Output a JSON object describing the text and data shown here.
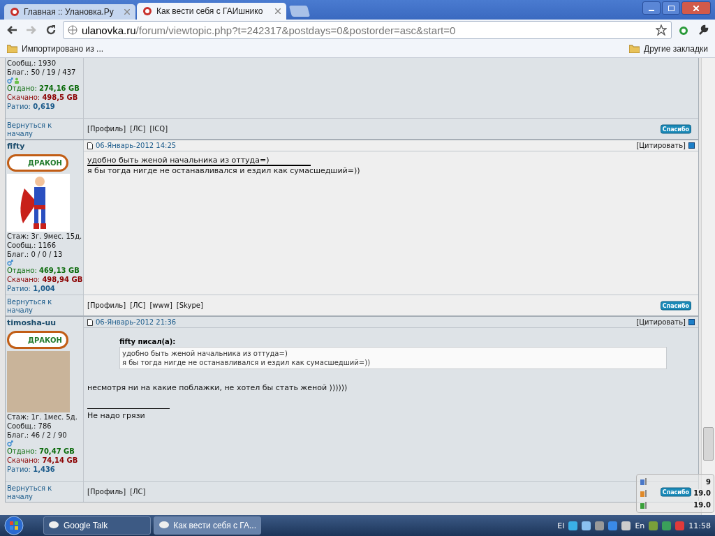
{
  "browser": {
    "tabs": [
      {
        "label": "Главная :: Улановка.Ру",
        "selected": false
      },
      {
        "label": "Как вести себя с ГАИшнико",
        "selected": true
      }
    ],
    "address": {
      "host": "ulanovka.ru",
      "path": "/forum/viewtopic.php?t=242317&postdays=0&postorder=asc&start=0"
    },
    "bookmarks": [
      {
        "label": "Импортировано из ..."
      },
      {
        "label": "Другие закладки"
      }
    ]
  },
  "posts": [
    {
      "stats": [
        {
          "kind": "plain",
          "label": "Сообщ.:",
          "value": "1930"
        },
        {
          "kind": "plain",
          "label": "Благ.:",
          "value": "50 / 19 / 437"
        },
        {
          "kind": "badges",
          "extra": true
        },
        {
          "kind": "up",
          "label": "Отдано:",
          "value": "274,16 GB"
        },
        {
          "kind": "down",
          "label": "Скачано:",
          "value": "498,5 GB"
        },
        {
          "kind": "ratio",
          "label": "Ратио:",
          "value": "0,619"
        }
      ],
      "back": "Вернуться к началу",
      "links": [
        "[Профиль]",
        "[ЛС]",
        "[ICQ]"
      ],
      "thanks": "Спасибо"
    },
    {
      "author": "fifty",
      "rank": "ДРАКОН",
      "date": "06-Январь-2012 14:25",
      "quote_action": "[Цитировать]",
      "avatar": {
        "kind": "figure"
      },
      "stats": [
        {
          "kind": "plain",
          "label": "Стаж:",
          "value": "3г. 9мес. 15д."
        },
        {
          "kind": "plain",
          "label": "Сообщ.:",
          "value": "1166"
        },
        {
          "kind": "plain",
          "label": "Благ.:",
          "value": "0 / 0 / 13"
        },
        {
          "kind": "badges",
          "extra": false
        },
        {
          "kind": "up",
          "label": "Отдано:",
          "value": "469,13 GB"
        },
        {
          "kind": "down",
          "label": "Скачано:",
          "value": "498,94 GB"
        },
        {
          "kind": "ratio",
          "label": "Ратио:",
          "value": "1,004"
        }
      ],
      "body": [
        {
          "text": "удобно быть женой начальника из оттуда=)",
          "underlined": true
        },
        {
          "text": "я бы тогда нигде не останавливался и ездил как сумасшедший=))",
          "underlined": false
        }
      ],
      "back": "Вернуться к началу",
      "links": [
        "[Профиль]",
        "[ЛС]",
        "[www]",
        "[Skype]"
      ],
      "thanks": "Спасибо"
    },
    {
      "author": "timosha-uu",
      "rank": "ДРАКОН",
      "date": "06-Январь-2012 21:36",
      "quote_action": "[Цитировать]",
      "avatar": {
        "kind": "photo"
      },
      "stats": [
        {
          "kind": "plain",
          "label": "Стаж:",
          "value": "1г. 1мес. 5д."
        },
        {
          "kind": "plain",
          "label": "Сообщ.:",
          "value": "786"
        },
        {
          "kind": "plain",
          "label": "Благ.:",
          "value": "46 / 2 / 90"
        },
        {
          "kind": "badges",
          "extra": false
        },
        {
          "kind": "up",
          "label": "Отдано:",
          "value": "70,47 GB"
        },
        {
          "kind": "down",
          "label": "Скачано:",
          "value": "74,14 GB"
        },
        {
          "kind": "ratio",
          "label": "Ратио:",
          "value": "1,436"
        }
      ],
      "quote": {
        "title": "fifty писал(а):",
        "lines": [
          "удобно быть женой начальника из оттуда=)",
          "я бы тогда нигде не останавливался и ездил как сумасшедший=))"
        ]
      },
      "body": [
        {
          "text": "несмотря ни на какие поблажки, не хотел бы стать женой ))))))",
          "underlined": false
        }
      ],
      "signature": "Не надо грязи",
      "back": "Вернуться к началу",
      "links": [
        "[Профиль]",
        "[ЛС]"
      ],
      "thanks": "Спасибо"
    }
  ],
  "gadget": {
    "values": [
      "9",
      "19.0",
      "19.0"
    ]
  },
  "taskbar": {
    "items": [
      {
        "label": "Google Talk",
        "selected": false
      },
      {
        "label": "Как вести себя с ГА...",
        "selected": true
      }
    ],
    "tray": [
      "El",
      "En"
    ],
    "clock": "11:58"
  }
}
